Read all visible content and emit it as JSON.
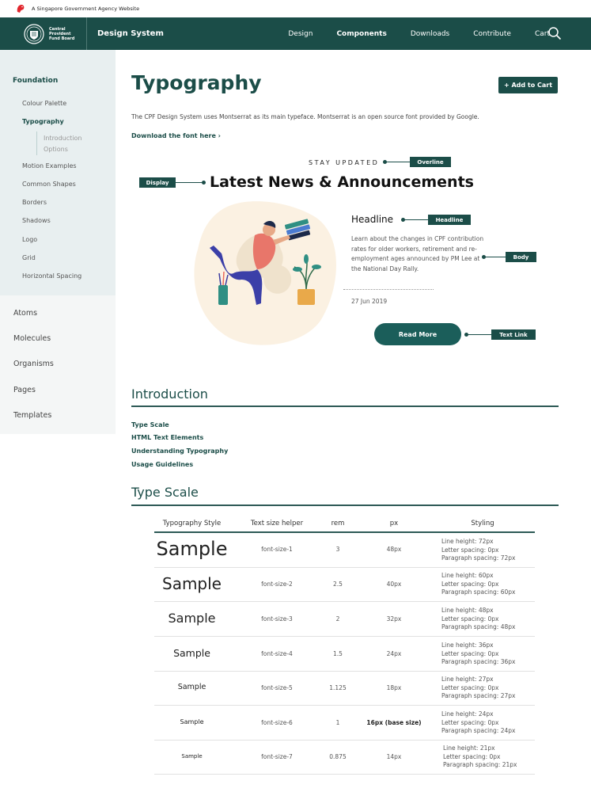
{
  "gov_bar": {
    "text": "A Singapore Government Agency Website"
  },
  "header": {
    "brand_text": "Central\nProvident\nFund Board",
    "title": "Design System",
    "nav": [
      "Design",
      "Components",
      "Downloads",
      "Contribute",
      "Cart"
    ],
    "active_nav": "Components"
  },
  "sidebar": {
    "foundation": "Foundation",
    "items": [
      "Colour Palette",
      "Typography",
      "Motion Examples",
      "Common Shapes",
      "Borders",
      "Shadows",
      "Logo",
      "Grid",
      "Horizontal Spacing"
    ],
    "typography_sub": [
      "Introduction",
      "Options"
    ],
    "main": [
      "Atoms",
      "Molecules",
      "Organisms",
      "Pages",
      "Templates"
    ]
  },
  "page": {
    "title": "Typography",
    "add_to_cart": "+ Add to Cart",
    "intro": "The CPF Design System uses Montserrat as its main typeface. Montserrat is an open source font provided by Google.",
    "download_link": "Download the font here  ›"
  },
  "example": {
    "overline": "STAY UPDATED",
    "display": "Latest News & Announcements",
    "headline": "Headline",
    "body": "Learn about the changes in CPF contribution rates for older workers, retirement and re-employment ages announced by PM Lee at the National Day Rally.",
    "date": "27 Jun 2019",
    "button": "Read More",
    "tags": {
      "overline": "Overline",
      "display": "Display",
      "headline": "Headline",
      "body": "Body",
      "text_link": "Text Link"
    }
  },
  "introduction": {
    "title": "Introduction",
    "links": [
      "Type Scale",
      "HTML Text Elements",
      "Understanding Typography",
      "Usage Guidelines"
    ]
  },
  "type_scale": {
    "title": "Type Scale",
    "headers": [
      "Typography Style",
      "Text size helper",
      "rem",
      "px",
      "Styling"
    ],
    "rows": [
      {
        "sample": "Sample",
        "helper": "font-size-1",
        "rem": "3",
        "px": "48px",
        "styling": [
          "Line height: 72px",
          "Letter spacing: 0px",
          "Paragraph spacing: 72px"
        ]
      },
      {
        "sample": "Sample",
        "helper": "font-size-2",
        "rem": "2.5",
        "px": "40px",
        "styling": [
          "Line height: 60px",
          "Letter spacing: 0px",
          "Paragraph spacing: 60px"
        ]
      },
      {
        "sample": "Sample",
        "helper": "font-size-3",
        "rem": "2",
        "px": "32px",
        "styling": [
          "Line height: 48px",
          "Letter spacing: 0px",
          "Paragraph spacing: 48px"
        ]
      },
      {
        "sample": "Sample",
        "helper": "font-size-4",
        "rem": "1.5",
        "px": "24px",
        "styling": [
          "Line height: 36px",
          "Letter spacing: 0px",
          "Paragraph spacing: 36px"
        ]
      },
      {
        "sample": "Sample",
        "helper": "font-size-5",
        "rem": "1.125",
        "px": "18px",
        "styling": [
          "Line height: 27px",
          "Letter spacing: 0px",
          "Paragraph spacing: 27px"
        ]
      },
      {
        "sample": "Sample",
        "helper": "font-size-6",
        "rem": "1",
        "px": "16px (base size)",
        "styling": [
          "Line height: 24px",
          "Letter spacing: 0px",
          "Paragraph spacing: 24px"
        ]
      },
      {
        "sample": "Sample",
        "helper": "font-size-7",
        "rem": "0.875",
        "px": "14px",
        "styling": [
          "Line height: 21px",
          "Letter spacing: 0px",
          "Paragraph spacing: 21px"
        ]
      }
    ]
  },
  "colors": {
    "primary": "#1b4d48",
    "sidebar_bg": "#e8eff0"
  }
}
